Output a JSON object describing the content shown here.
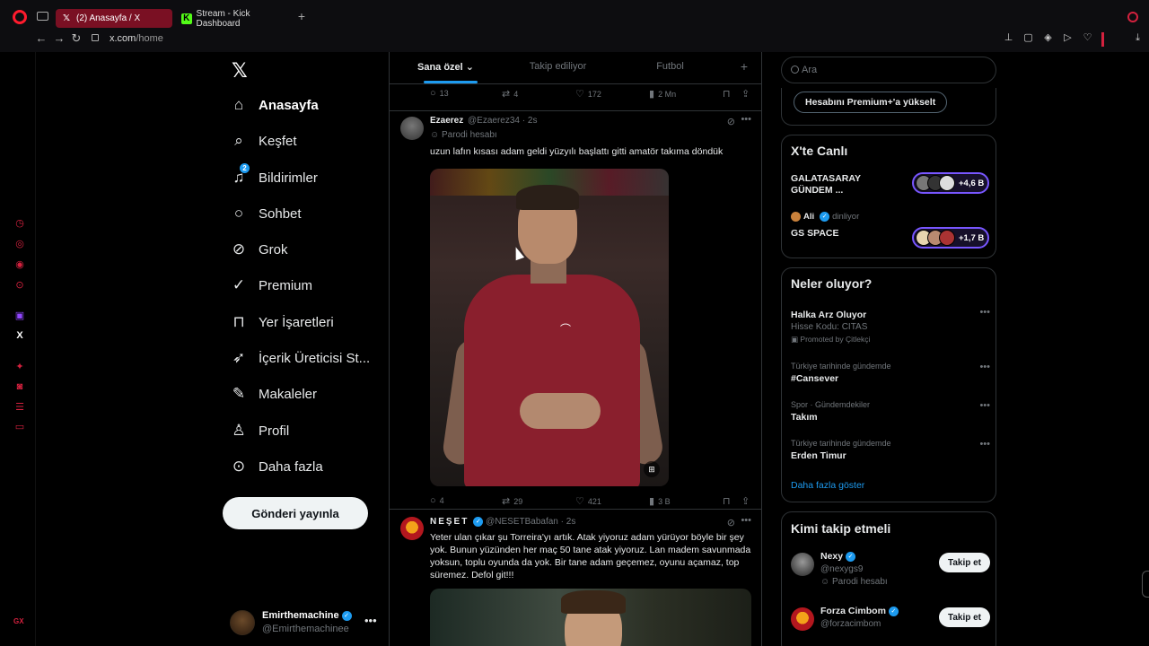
{
  "browser": {
    "tabs": [
      {
        "label": "(2) Anasayfa / X",
        "icon": "x-favicon"
      },
      {
        "label": "Stream - Kick Dashboard",
        "icon": "kick-favicon"
      }
    ],
    "url_host": "x.com",
    "url_path": "/home",
    "accent": "#ff1b2d"
  },
  "opera_sidebar": {
    "gx_label": "GX"
  },
  "leftnav": {
    "items": [
      {
        "label": "Anasayfa",
        "icon": "home-icon"
      },
      {
        "label": "Keşfet",
        "icon": "search-icon"
      },
      {
        "label": "Bildirimler",
        "icon": "bell-icon",
        "badge": "2"
      },
      {
        "label": "Sohbet",
        "icon": "message-icon"
      },
      {
        "label": "Grok",
        "icon": "grok-icon"
      },
      {
        "label": "Premium",
        "icon": "premium-icon"
      },
      {
        "label": "Yer İşaretleri",
        "icon": "bookmark-icon"
      },
      {
        "label": "İçerik Üreticisi St...",
        "icon": "rocket-icon"
      },
      {
        "label": "Makaleler",
        "icon": "article-icon"
      },
      {
        "label": "Profil",
        "icon": "person-icon"
      },
      {
        "label": "Daha fazla",
        "icon": "more-circle-icon"
      }
    ],
    "post_button": "Gönderi yayınla",
    "account": {
      "name": "Emirthemachine",
      "handle": "@Emirthemachinee"
    }
  },
  "timeline": {
    "tabs": [
      "Sana özel",
      "Takip ediliyor",
      "Futbol"
    ],
    "prev_actions": {
      "replies": "13",
      "reposts": "4",
      "likes": "172",
      "views": "2 Mn"
    },
    "tweets": [
      {
        "name": "Ezaerez",
        "handle": "@Ezaerez34",
        "time": "2s",
        "parody": "Parodi hesabı",
        "text": "uzun lafın kısası adam geldi yüzyılı başlattı gitti amatör takıma döndük",
        "actions": {
          "replies": "4",
          "reposts": "29",
          "likes": "421",
          "views": "3 B"
        }
      },
      {
        "name": "NEŞET",
        "handle": "@NESETBabafan",
        "time": "2s",
        "text": "Yeter ulan çıkar şu Torreira'yı artık. Atak yiyoruz adam yürüyor böyle bir şey yok. Bunun yüzünden her maç 50 tane atak yiyoruz. Lan madem savunmada yoksun, toplu oyunda da yok. Bir tane adam geçemez, oyunu açamaz, top süremez. Defol git!!!"
      }
    ]
  },
  "rightcol": {
    "search_placeholder": "Ara",
    "premium_button": "Hesabını Premium+'a yükselt",
    "live": {
      "title": "X'te Canlı",
      "spaces": [
        {
          "title": "GALATASARAY GÜNDEM ...",
          "count": "+4,6 B"
        },
        {
          "host": "Ali",
          "status": "dinliyor",
          "title": "GS SPACE",
          "count": "+1,7 B"
        }
      ]
    },
    "trends": {
      "title": "Neler oluyor?",
      "items": [
        {
          "name": "Halka Arz Oluyor",
          "sub": "Hisse Kodu: CITAS",
          "promo": "Promoted by Çitlekçi"
        },
        {
          "context": "Türkiye tarihinde gündemde",
          "name": "#Cansever"
        },
        {
          "context": "Spor · Gündemdekiler",
          "name": "Takım"
        },
        {
          "context": "Türkiye tarihinde gündemde",
          "name": "Erden Timur"
        }
      ],
      "show_more": "Daha fazla göster"
    },
    "who_to_follow": {
      "title": "Kimi takip etmeli",
      "users": [
        {
          "name": "Nexy",
          "handle": "@nexygs9",
          "parody": "Parodi hesabı",
          "button": "Takip et"
        },
        {
          "name": "Forza Cimbom",
          "handle": "@forzacimbom",
          "button": "Takip et"
        }
      ]
    }
  }
}
